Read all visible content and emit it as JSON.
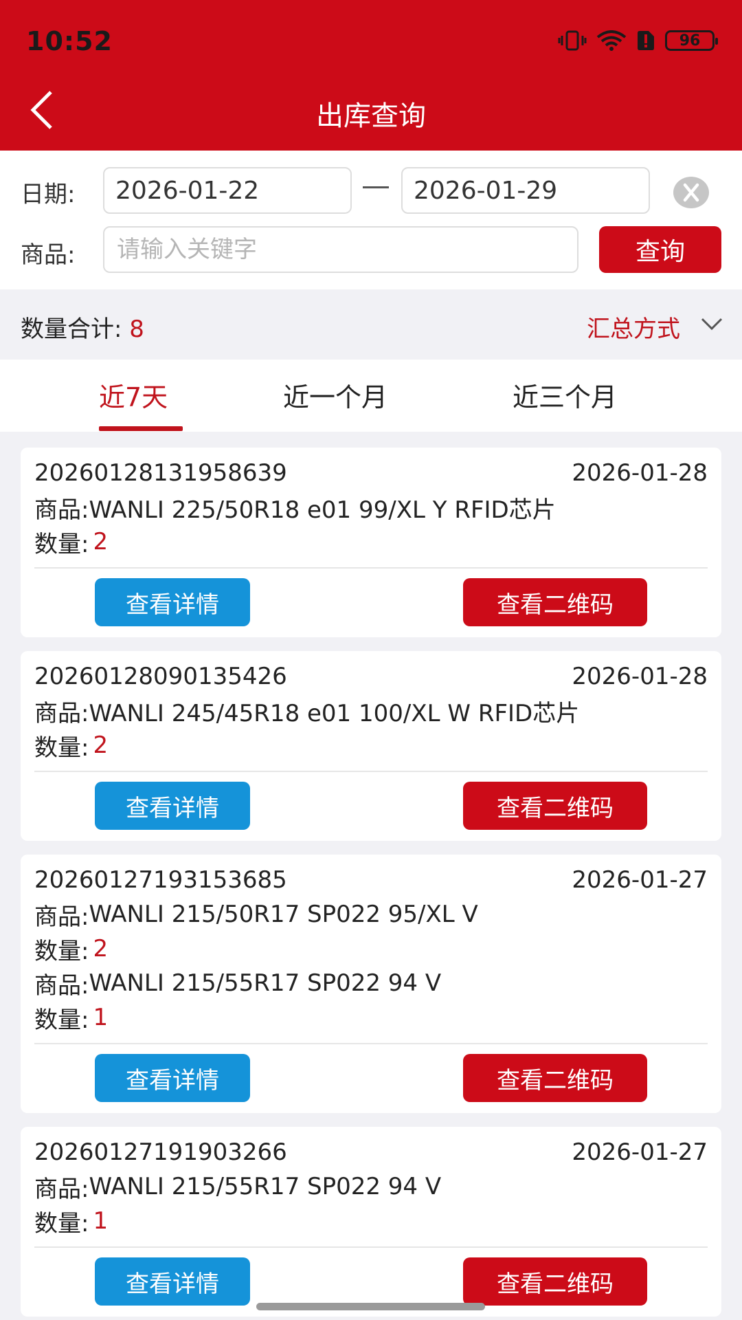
{
  "status_bar": {
    "time": "10:52",
    "battery": "96"
  },
  "header": {
    "title": "出库查询"
  },
  "filters": {
    "date_label": "日期:",
    "start_date": "2026-01-22",
    "end_date": "2026-01-29",
    "product_label": "商品:",
    "product_placeholder": "请输入关键字",
    "query_label": "查询"
  },
  "summary": {
    "label": "数量合计: ",
    "count": "8",
    "mode_label": "汇总方式"
  },
  "tabs": [
    {
      "label": "近7天",
      "active": true
    },
    {
      "label": "近一个月",
      "active": false
    },
    {
      "label": "近三个月",
      "active": false
    }
  ],
  "orders": [
    {
      "id": "20260128131958639",
      "date": "2026-01-28",
      "items": [
        {
          "product_label": "商品: ",
          "product": "WANLI 225/50R18 e01 99/XL Y RFID芯片",
          "qty_label": "数量:",
          "qty": "2"
        }
      ],
      "detail_label": "查看详情",
      "qr_label": "查看二维码"
    },
    {
      "id": "20260128090135426",
      "date": "2026-01-28",
      "items": [
        {
          "product_label": "商品: ",
          "product": "WANLI 245/45R18 e01 100/XL W RFID芯片",
          "qty_label": "数量:",
          "qty": "2"
        }
      ],
      "detail_label": "查看详情",
      "qr_label": "查看二维码"
    },
    {
      "id": "20260127193153685",
      "date": "2026-01-27",
      "items": [
        {
          "product_label": "商品: ",
          "product": "WANLI 215/50R17 SP022 95/XL V",
          "qty_label": "数量:",
          "qty": "2"
        },
        {
          "product_label": "商品: ",
          "product": "WANLI 215/55R17 SP022 94 V",
          "qty_label": "数量:",
          "qty": "1"
        }
      ],
      "detail_label": "查看详情",
      "qr_label": "查看二维码"
    },
    {
      "id": "20260127191903266",
      "date": "2026-01-27",
      "items": [
        {
          "product_label": "商品: ",
          "product": "WANLI 215/55R17 SP022 94 V",
          "qty_label": "数量:",
          "qty": "1"
        }
      ],
      "detail_label": "查看详情",
      "qr_label": "查看二维码"
    }
  ],
  "colors": {
    "brand_red": "#cc0b18",
    "detail_blue": "#1593d9",
    "qty_red": "#c0131c"
  }
}
